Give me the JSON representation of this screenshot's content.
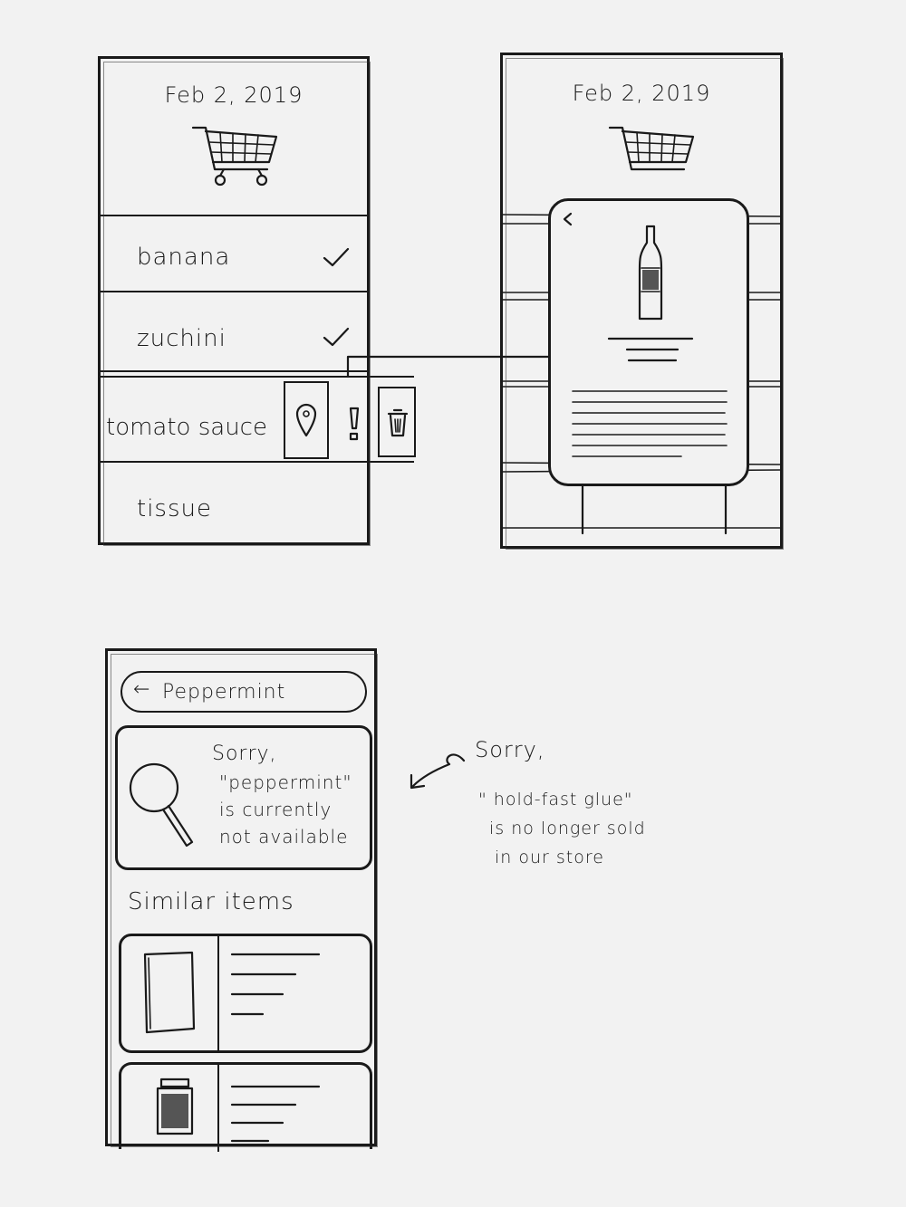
{
  "screen1": {
    "date": "Feb 2, 2019",
    "cart_icon": "shopping-cart-icon",
    "items": [
      {
        "label": "banana",
        "checked": true
      },
      {
        "label": "zuchini",
        "checked": true
      },
      {
        "label": "tomato sauce",
        "checked": false,
        "actions": [
          "location-pin-icon",
          "alert-icon",
          "trash-icon"
        ]
      },
      {
        "label": "tissue",
        "checked": false
      }
    ]
  },
  "screen2": {
    "date": "Feb 2, 2019",
    "cart_icon": "shopping-cart-icon",
    "popup": {
      "back_icon": "chevron-left-icon",
      "image_icon": "bottle-icon"
    }
  },
  "screen3": {
    "search": {
      "back_icon": "arrow-left-icon",
      "query": "Peppermint"
    },
    "notice": {
      "icon": "magnifier-icon",
      "lines": [
        "Sorry,",
        "\"peppermint\"",
        "is currently",
        "not available"
      ]
    },
    "similar_heading": "Similar items",
    "similar_items": [
      {
        "thumb_icon": "package-icon"
      },
      {
        "thumb_icon": "jar-icon"
      }
    ]
  },
  "annotation": {
    "lines": [
      "Sorry,",
      "\" hold-fast glue\"",
      "is no longer sold",
      "in our store"
    ]
  }
}
